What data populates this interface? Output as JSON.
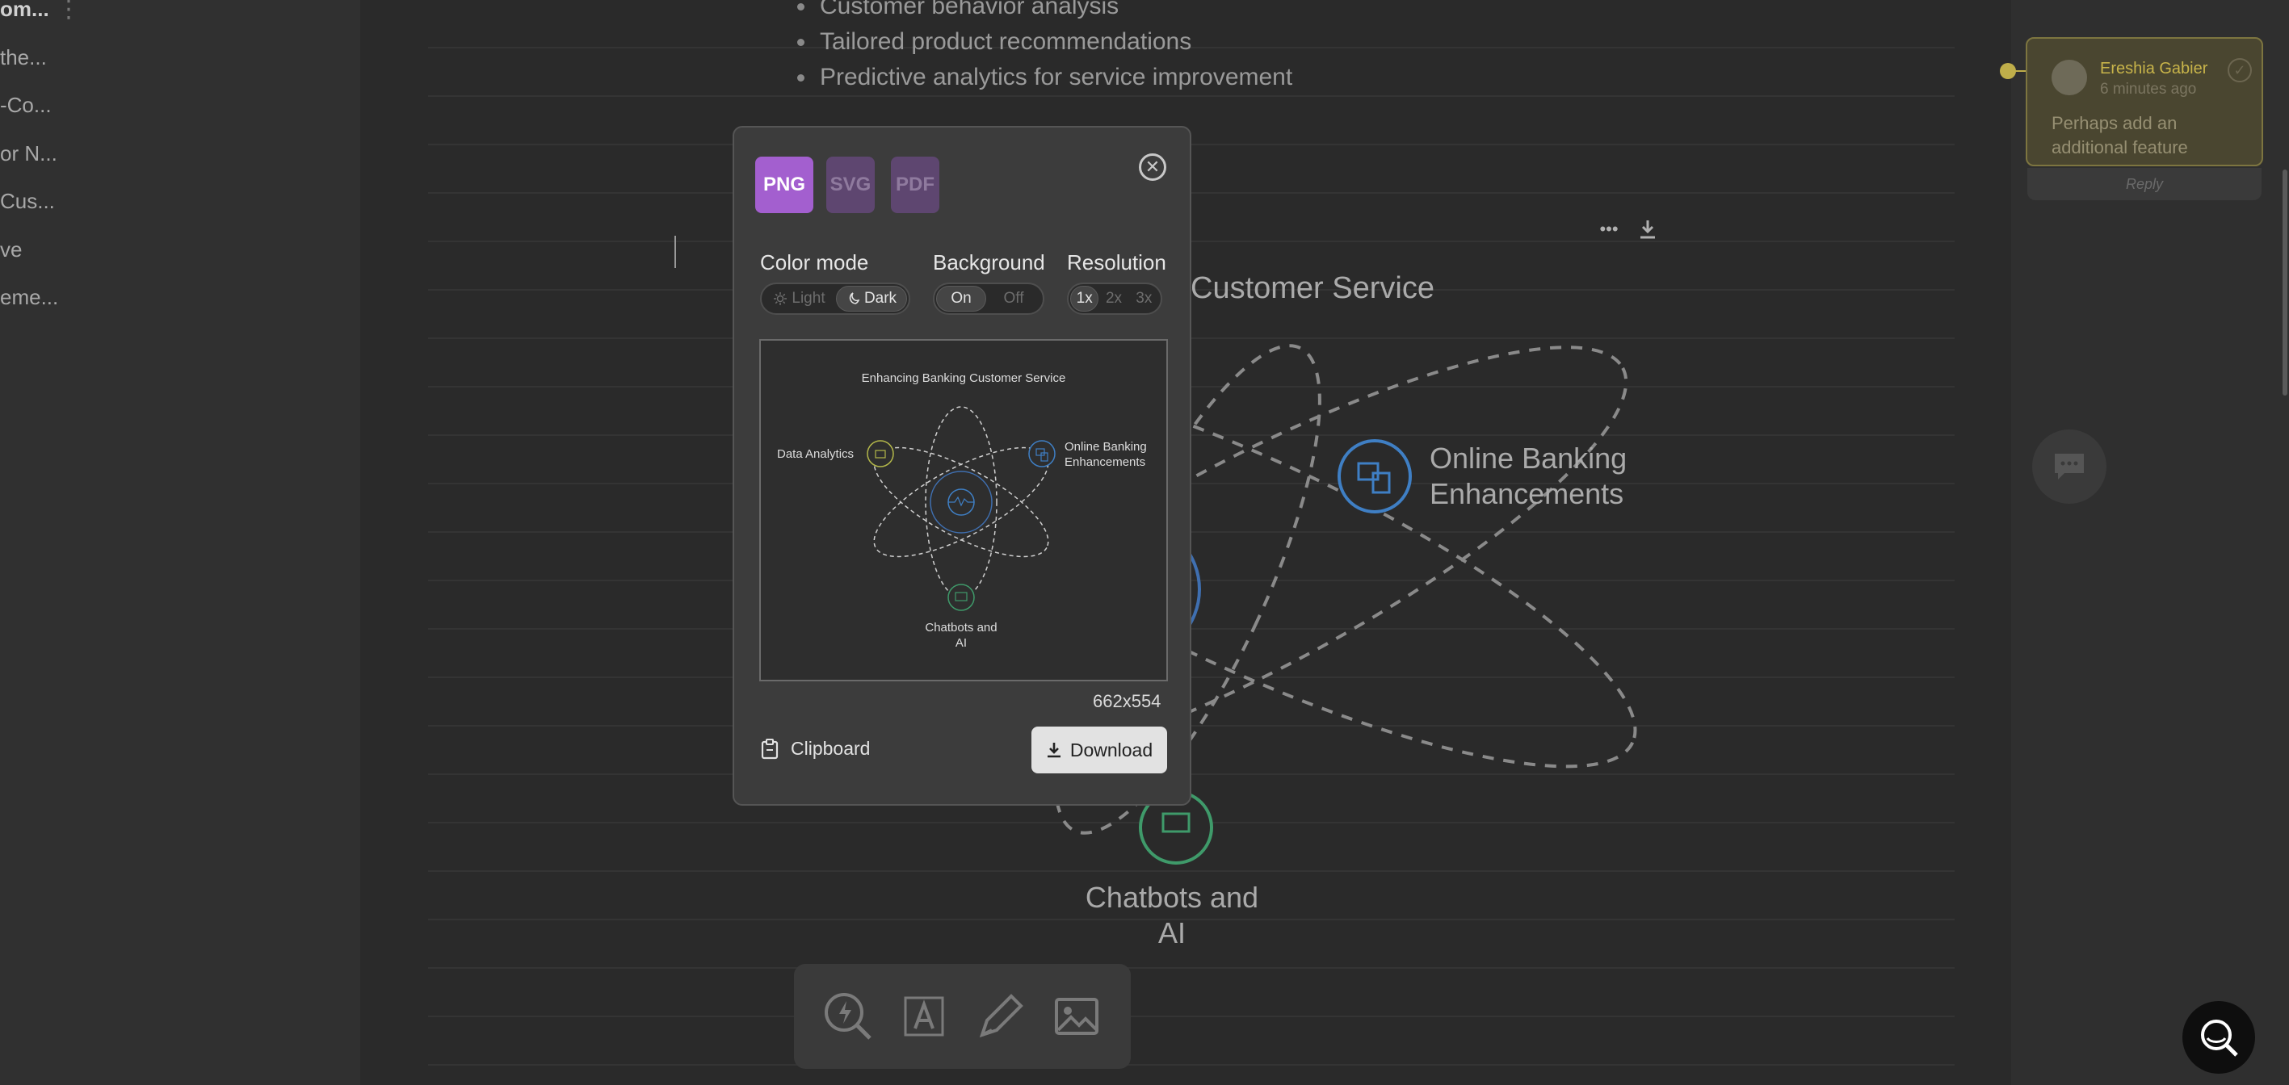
{
  "sidebar": {
    "items": [
      "om...",
      "the...",
      "-Co...",
      "or N...",
      "Cus...",
      "ve",
      "eme..."
    ]
  },
  "document": {
    "bullets": [
      "Customer behavior analysis",
      "Tailored product recommendations",
      "Predictive analytics for service improvement"
    ]
  },
  "diagram_background": {
    "title_fragment": "Customer Service",
    "label_online_line1": "Online Banking",
    "label_online_line2": "Enhancements",
    "label_chat_line1": "Chatbots and",
    "label_chat_line2": "AI"
  },
  "comment": {
    "author": "Ereshia Gabier",
    "time": "6 minutes ago",
    "text": "Perhaps add an additional feature",
    "reply_label": "Reply",
    "highlight_color": "#bfae4a"
  },
  "export_modal": {
    "formats": [
      "PNG",
      "SVG",
      "PDF"
    ],
    "selected_format": "PNG",
    "color_mode": {
      "label": "Color mode",
      "options": [
        "Light",
        "Dark"
      ],
      "selected": "Dark"
    },
    "background": {
      "label": "Background",
      "options": [
        "On",
        "Off"
      ],
      "selected": "On"
    },
    "resolution": {
      "label": "Resolution",
      "options": [
        "1x",
        "2x",
        "3x"
      ],
      "selected": "1x"
    },
    "preview": {
      "title": "Enhancing Banking Customer Service",
      "label_data": "Data Analytics",
      "label_online_line1": "Online Banking",
      "label_online_line2": "Enhancements",
      "label_chat_line1": "Chatbots and",
      "label_chat_line2": "AI"
    },
    "dimensions": "662x554",
    "clipboard_label": "Clipboard",
    "download_label": "Download"
  },
  "colors": {
    "accent_purple": "#a35fcf",
    "icon_blue": "#3f7fc4",
    "icon_green": "#3f9a6a",
    "icon_yellow": "#b4b84a"
  }
}
